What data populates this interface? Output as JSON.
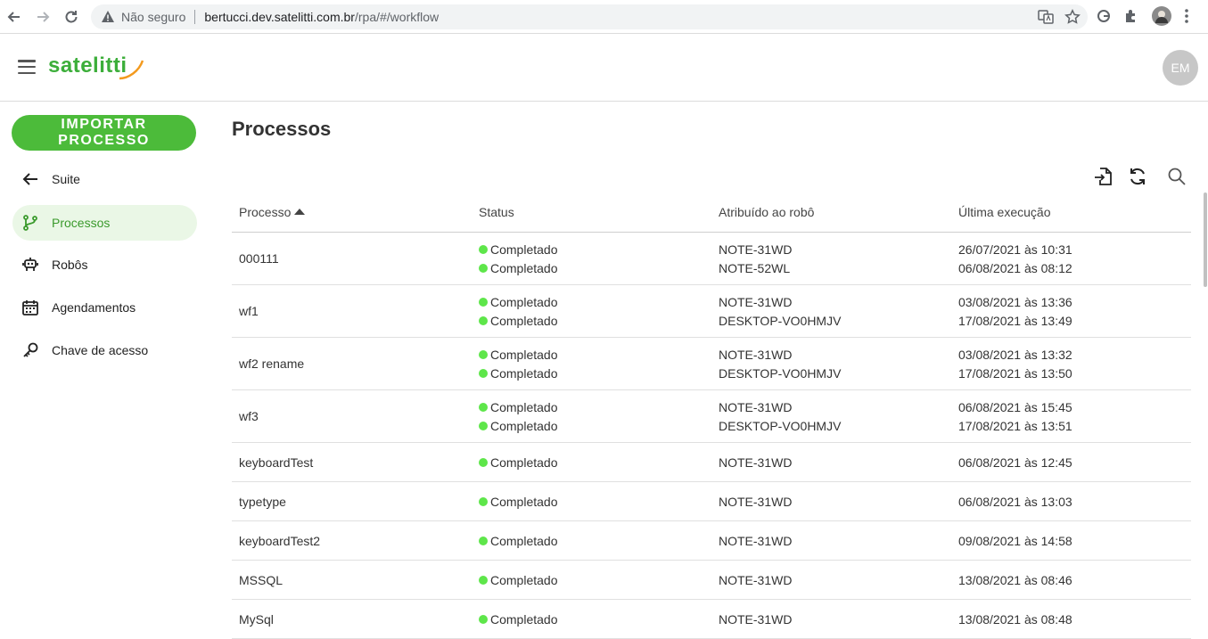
{
  "browser": {
    "insecure_label": "Não seguro",
    "url_host": "bertucci.dev.satelitti.com.br",
    "url_path": "/rpa/#/workflow"
  },
  "header": {
    "logo_text": "satelitti",
    "avatar_initials": "EM"
  },
  "sidebar": {
    "import_button": "IMPORTAR PROCESSO",
    "items": [
      {
        "label": "Suite",
        "icon": "arrow-left-icon"
      },
      {
        "label": "Processos",
        "icon": "branch-icon",
        "active": true
      },
      {
        "label": "Robôs",
        "icon": "robot-icon"
      },
      {
        "label": "Agendamentos",
        "icon": "calendar-icon"
      },
      {
        "label": "Chave de acesso",
        "icon": "key-icon"
      }
    ]
  },
  "main": {
    "title": "Processos",
    "columns": [
      "Processo",
      "Status",
      "Atribuído ao robô",
      "Última execução"
    ],
    "rows": [
      {
        "name": "000111",
        "status": [
          "Completado",
          "Completado"
        ],
        "robots": [
          "NOTE-31WD",
          "NOTE-52WL"
        ],
        "dates": [
          "26/07/2021 às 10:31",
          "06/08/2021 às 08:12"
        ]
      },
      {
        "name": "wf1",
        "status": [
          "Completado",
          "Completado"
        ],
        "robots": [
          "NOTE-31WD",
          "DESKTOP-VO0HMJV"
        ],
        "dates": [
          "03/08/2021 às 13:36",
          "17/08/2021 às 13:49"
        ]
      },
      {
        "name": "wf2 rename",
        "status": [
          "Completado",
          "Completado"
        ],
        "robots": [
          "NOTE-31WD",
          "DESKTOP-VO0HMJV"
        ],
        "dates": [
          "03/08/2021 às 13:32",
          "17/08/2021 às 13:50"
        ]
      },
      {
        "name": "wf3",
        "status": [
          "Completado",
          "Completado"
        ],
        "robots": [
          "NOTE-31WD",
          "DESKTOP-VO0HMJV"
        ],
        "dates": [
          "06/08/2021 às 15:45",
          "17/08/2021 às 13:51"
        ]
      },
      {
        "name": "keyboardTest",
        "status": [
          "Completado"
        ],
        "robots": [
          "NOTE-31WD"
        ],
        "dates": [
          "06/08/2021 às 12:45"
        ]
      },
      {
        "name": "typetype",
        "status": [
          "Completado"
        ],
        "robots": [
          "NOTE-31WD"
        ],
        "dates": [
          "06/08/2021 às 13:03"
        ]
      },
      {
        "name": "keyboardTest2",
        "status": [
          "Completado"
        ],
        "robots": [
          "NOTE-31WD"
        ],
        "dates": [
          "09/08/2021 às 14:58"
        ]
      },
      {
        "name": "MSSQL",
        "status": [
          "Completado"
        ],
        "robots": [
          "NOTE-31WD"
        ],
        "dates": [
          "13/08/2021 às 08:46"
        ]
      },
      {
        "name": "MySql",
        "status": [
          "Completado"
        ],
        "robots": [
          "NOTE-31WD"
        ],
        "dates": [
          "13/08/2021 às 08:48"
        ]
      }
    ]
  },
  "colors": {
    "brand_green": "#4cbb3a",
    "status_green": "#5ee64a",
    "active_bg": "#eaf7e6"
  }
}
